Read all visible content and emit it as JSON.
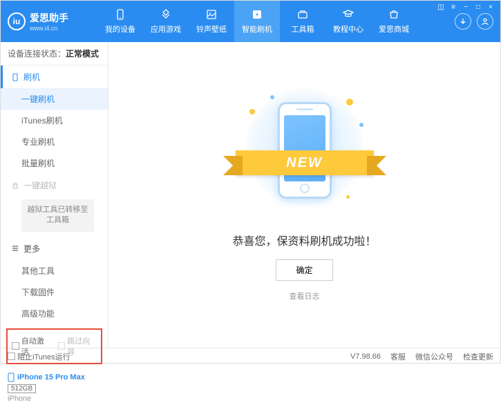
{
  "header": {
    "logo_title": "爱思助手",
    "logo_sub": "www.i4.cn",
    "nav": [
      {
        "label": "我的设备",
        "icon": "device"
      },
      {
        "label": "应用游戏",
        "icon": "apps"
      },
      {
        "label": "铃声壁纸",
        "icon": "media"
      },
      {
        "label": "智能刷机",
        "icon": "flash",
        "active": true
      },
      {
        "label": "工具箱",
        "icon": "toolbox"
      },
      {
        "label": "教程中心",
        "icon": "tutorial"
      },
      {
        "label": "爱思商城",
        "icon": "store"
      }
    ]
  },
  "sidebar": {
    "status_label": "设备连接状态：",
    "status_value": "正常模式",
    "section_flash": "刷机",
    "items_flash": [
      "一键刷机",
      "iTunes刷机",
      "专业刷机",
      "批量刷机"
    ],
    "section_jailbreak": "一键越狱",
    "jailbreak_notice": "越狱工具已转移至工具箱",
    "section_more": "更多",
    "items_more": [
      "其他工具",
      "下载固件",
      "高级功能"
    ],
    "checkbox1": "自动激活",
    "checkbox2": "跳过向导",
    "device": {
      "name": "iPhone 15 Pro Max",
      "storage": "512GB",
      "type": "iPhone"
    }
  },
  "main": {
    "ribbon": "NEW",
    "success": "恭喜您，保资料刷机成功啦！",
    "ok": "确定",
    "log": "查看日志"
  },
  "footer": {
    "block_itunes": "阻止iTunes运行",
    "version": "V7.98.66",
    "links": [
      "客服",
      "微信公众号",
      "检查更新"
    ]
  }
}
